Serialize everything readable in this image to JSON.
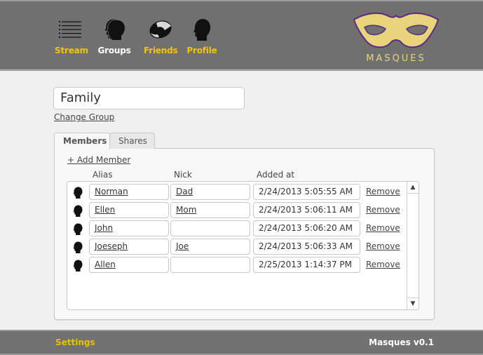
{
  "header": {
    "nav": [
      {
        "label": "Stream",
        "icon": "stream-list-icon",
        "active": false
      },
      {
        "label": "Groups",
        "icon": "groups-heads-icon",
        "active": true
      },
      {
        "label": "Friends",
        "icon": "handshake-icon",
        "active": false
      },
      {
        "label": "Profile",
        "icon": "profile-head-icon",
        "active": false
      }
    ],
    "logo_text": "MASQUES",
    "logo_icon": "masquerade-mask-icon"
  },
  "group": {
    "name": "Family",
    "change_label": "Change Group"
  },
  "tabs": [
    {
      "label": "Members",
      "active": true
    },
    {
      "label": "Shares",
      "active": false
    }
  ],
  "members": {
    "add_label": "+ Add Member",
    "columns": {
      "alias": "Alias",
      "nick": "Nick",
      "added": "Added at"
    },
    "remove_label": "Remove",
    "rows": [
      {
        "alias": "Norman",
        "nick": "Dad",
        "added": "2/24/2013 5:05:55 AM"
      },
      {
        "alias": "Ellen",
        "nick": "Mom",
        "added": "2/24/2013 5:06:11 AM"
      },
      {
        "alias": "John",
        "nick": "",
        "added": "2/24/2013 5:06:20 AM"
      },
      {
        "alias": "Joeseph",
        "nick": "Joe",
        "added": "2/24/2013 5:06:33 AM"
      },
      {
        "alias": "Allen",
        "nick": "",
        "added": "2/25/2013 1:14:37 PM"
      }
    ]
  },
  "footer": {
    "settings_label": "Settings",
    "version": "Masques v0.1"
  },
  "colors": {
    "nav_accent": "#f1c40f",
    "header_bg": "#707070",
    "logo_fill": "#e8d47a",
    "logo_stroke": "#5b2a86"
  }
}
